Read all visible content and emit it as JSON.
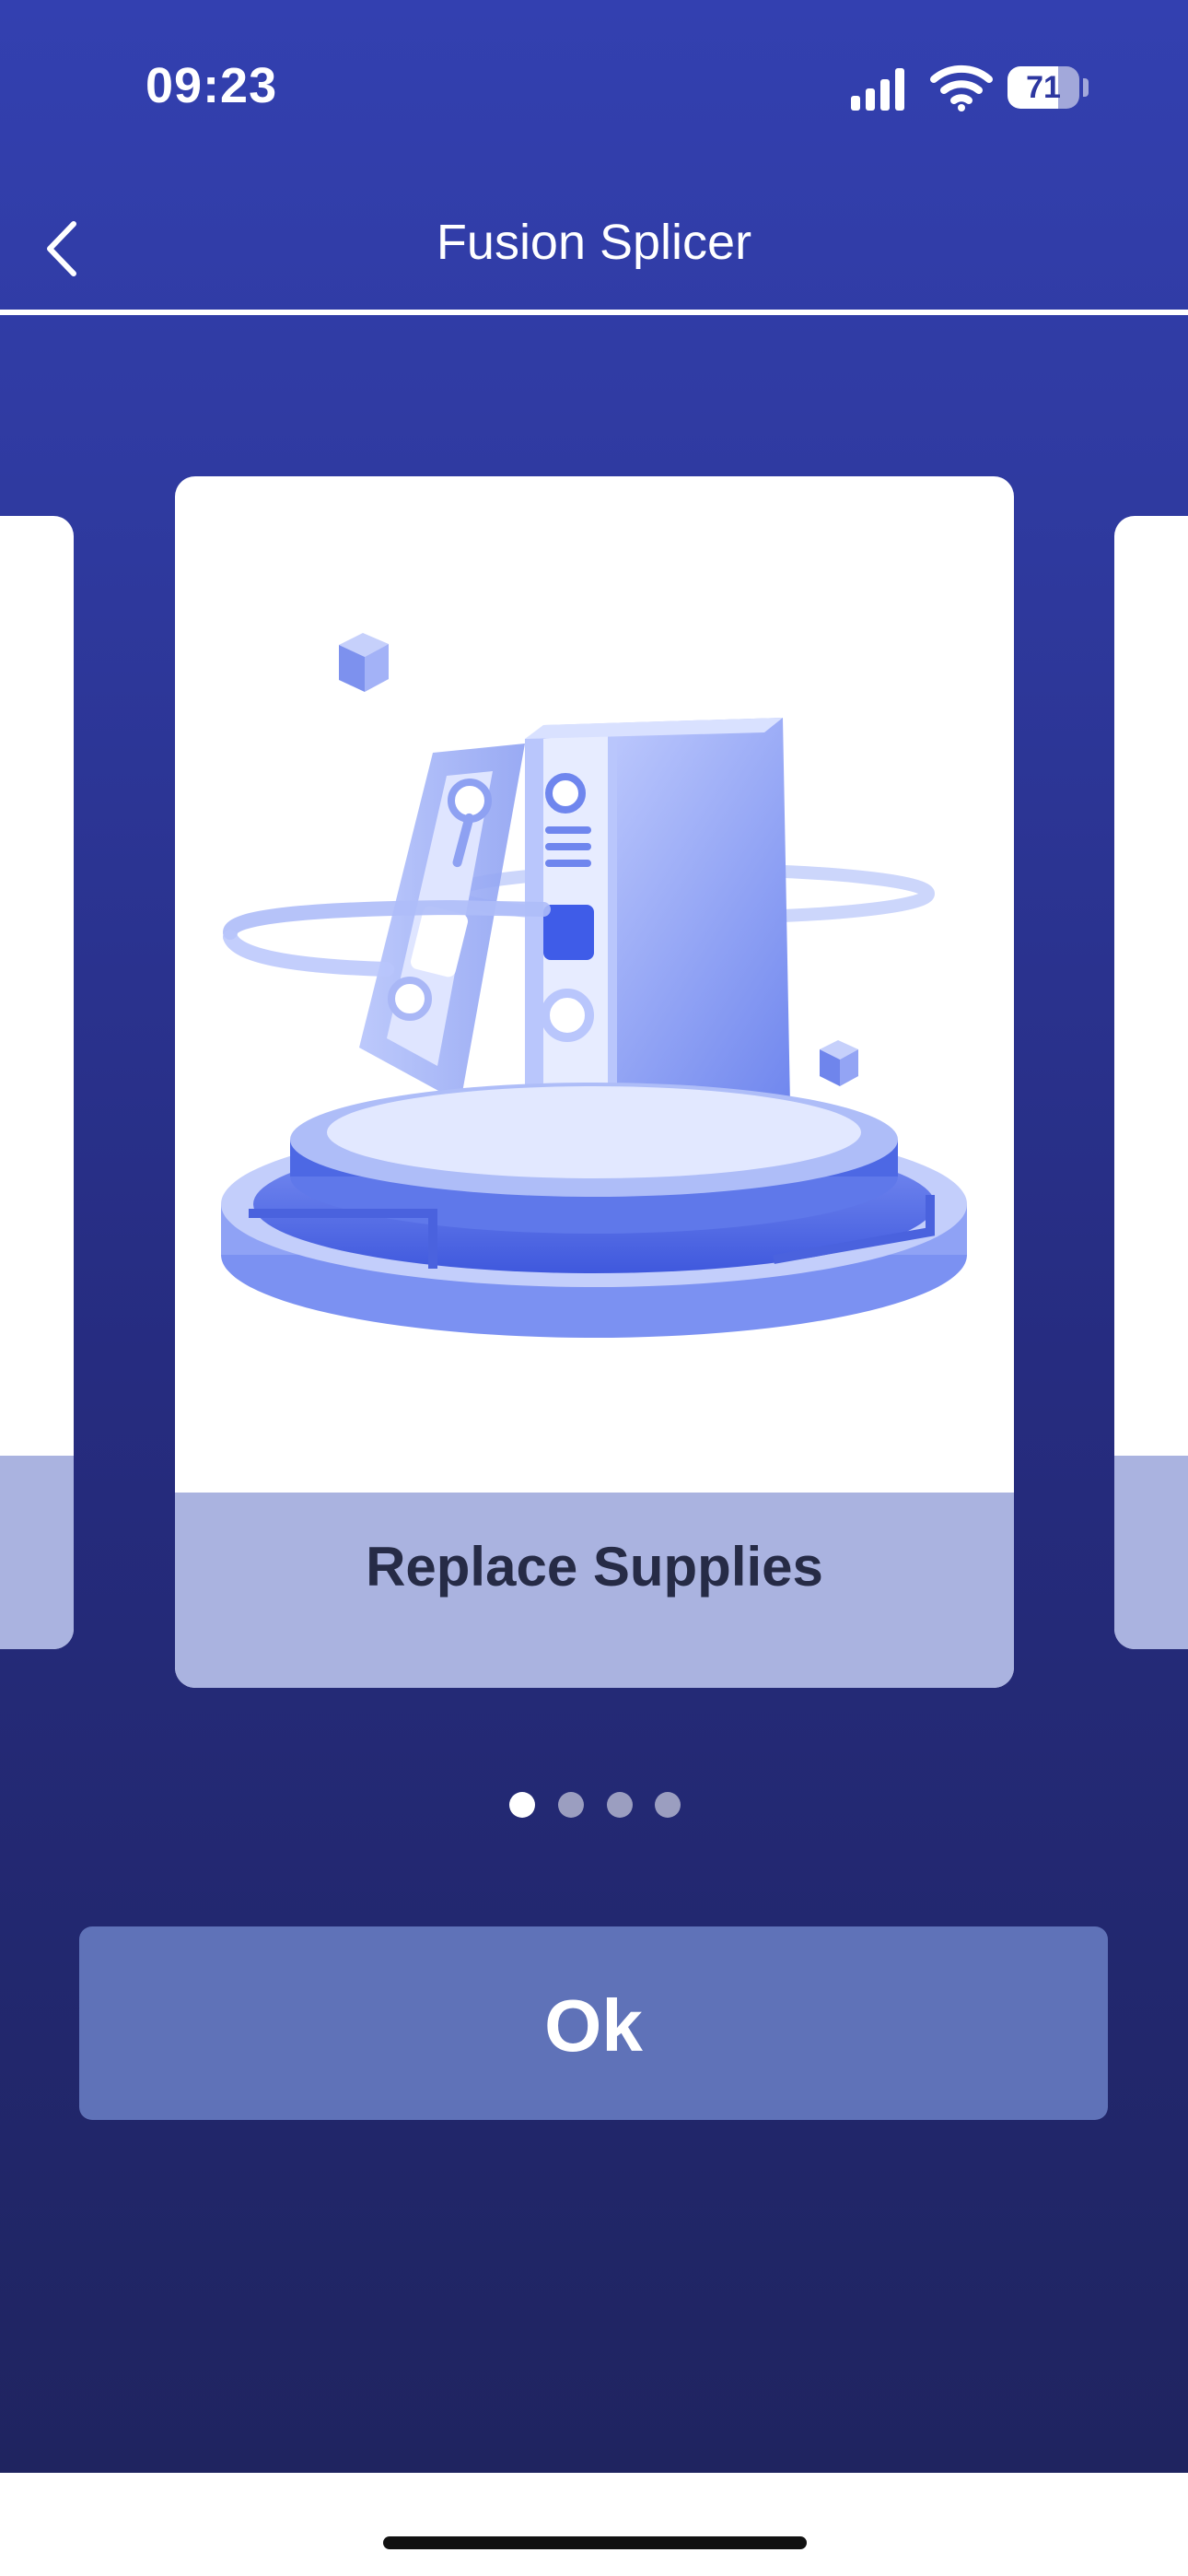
{
  "status_bar": {
    "time": "09:23",
    "battery_level": "71",
    "icons": [
      "signal-icon",
      "wifi-icon",
      "battery-icon"
    ]
  },
  "nav": {
    "title": "Fusion Splicer",
    "back_icon": "chevron-left-icon"
  },
  "carousel": {
    "current_card": {
      "label": "Replace Supplies",
      "illustration": "binders-on-podium-illustration"
    },
    "page_count": 4,
    "active_index": 0
  },
  "actions": {
    "ok_label": "Ok"
  },
  "colors": {
    "background_top": "#3340b0",
    "background_bottom": "#1f2460",
    "label_band": "#aab3e0",
    "button": "#5f72b8"
  }
}
